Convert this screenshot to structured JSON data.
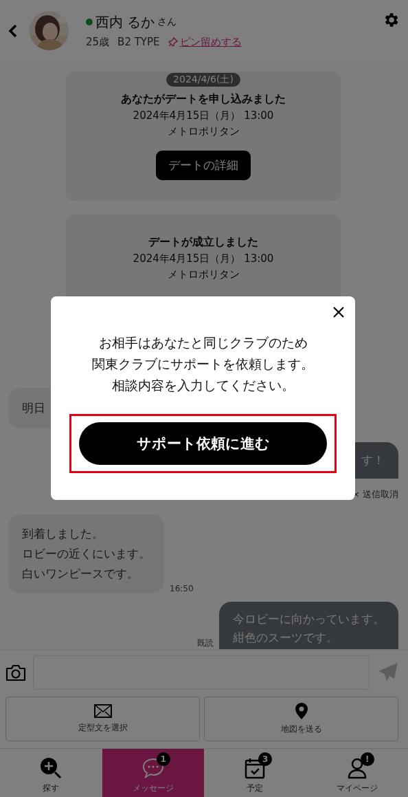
{
  "header": {
    "online": true,
    "name": "西内 るか",
    "honorific": "さん",
    "age": "25歳",
    "type": "B2 TYPE",
    "pin_link": "ピン留めする"
  },
  "cards": [
    {
      "date_badge": "2024/4/6(土)",
      "title": "あなたがデートを申し込みました",
      "datetime": "2024年4月15日（月） 13:00",
      "place": "メトロポリタン",
      "button": "デートの詳細"
    },
    {
      "title": "デートが成立しました",
      "datetime": "2024年4月15日（月） 13:00",
      "place": "メトロポリタン"
    }
  ],
  "messages": [
    {
      "kind": "received",
      "lines": [
        "明日"
      ]
    },
    {
      "kind": "sent",
      "lines": [
        "す！"
      ],
      "status": "× 送信取消"
    },
    {
      "kind": "received",
      "lines": [
        "到着しました。",
        "ロビーの近くにいます。",
        "白いワンピースです。"
      ],
      "time": "16:50"
    },
    {
      "kind": "sent",
      "lines": [
        "今ロビーに向かっています。",
        "紺色のスーツです。"
      ],
      "read": "既読"
    }
  ],
  "quick_actions": [
    {
      "kind": "template",
      "label": "定型文を選択"
    },
    {
      "kind": "map",
      "label": "地図を送る"
    }
  ],
  "nav": [
    {
      "kind": "search",
      "label": "探す",
      "selected": false
    },
    {
      "kind": "message",
      "label": "メッセージ",
      "badge": "1",
      "selected": true
    },
    {
      "kind": "calendar",
      "label": "予定",
      "badge": "3",
      "selected": false
    },
    {
      "kind": "person",
      "label": "マイページ",
      "badge": "!",
      "selected": false
    }
  ],
  "modal": {
    "message": [
      "お相手はあなたと同じクラブのため",
      "関東クラブにサポートを依頼します。",
      "相談内容を入力してください。"
    ],
    "button": "サポート依頼に進む",
    "highlighted": true
  }
}
